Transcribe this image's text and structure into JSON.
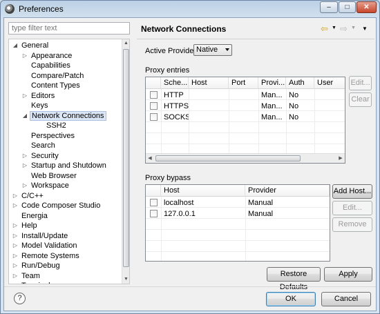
{
  "window": {
    "title": "Preferences",
    "icon": "eclipse-gear-icon",
    "controls": [
      "minimize-icon",
      "maximize-icon",
      "close-icon"
    ]
  },
  "filter": {
    "placeholder": "type filter text",
    "value": ""
  },
  "tree": {
    "items": [
      {
        "label": "General",
        "level": 0,
        "expander": "expanded"
      },
      {
        "label": "Appearance",
        "level": 1,
        "expander": "collapsed"
      },
      {
        "label": "Capabilities",
        "level": 1,
        "expander": "none"
      },
      {
        "label": "Compare/Patch",
        "level": 1,
        "expander": "none"
      },
      {
        "label": "Content Types",
        "level": 1,
        "expander": "none"
      },
      {
        "label": "Editors",
        "level": 1,
        "expander": "collapsed"
      },
      {
        "label": "Keys",
        "level": 1,
        "expander": "none"
      },
      {
        "label": "Network Connections",
        "level": 1,
        "expander": "expanded",
        "selected": true
      },
      {
        "label": "SSH2",
        "level": 2,
        "expander": "none"
      },
      {
        "label": "Perspectives",
        "level": 1,
        "expander": "none"
      },
      {
        "label": "Search",
        "level": 1,
        "expander": "none"
      },
      {
        "label": "Security",
        "level": 1,
        "expander": "collapsed"
      },
      {
        "label": "Startup and Shutdown",
        "level": 1,
        "expander": "collapsed"
      },
      {
        "label": "Web Browser",
        "level": 1,
        "expander": "none"
      },
      {
        "label": "Workspace",
        "level": 1,
        "expander": "collapsed"
      },
      {
        "label": "C/C++",
        "level": 0,
        "expander": "collapsed"
      },
      {
        "label": "Code Composer Studio",
        "level": 0,
        "expander": "collapsed"
      },
      {
        "label": "Energia",
        "level": 0,
        "expander": "none"
      },
      {
        "label": "Help",
        "level": 0,
        "expander": "collapsed"
      },
      {
        "label": "Install/Update",
        "level": 0,
        "expander": "collapsed"
      },
      {
        "label": "Model Validation",
        "level": 0,
        "expander": "collapsed"
      },
      {
        "label": "Remote Systems",
        "level": 0,
        "expander": "collapsed"
      },
      {
        "label": "Run/Debug",
        "level": 0,
        "expander": "collapsed"
      },
      {
        "label": "Team",
        "level": 0,
        "expander": "collapsed"
      },
      {
        "label": "Terminal",
        "level": 0,
        "expander": "none"
      }
    ]
  },
  "page": {
    "title": "Network Connections",
    "nav_icons": [
      "back-arrow-icon",
      "back-menu-icon",
      "forward-arrow-icon",
      "forward-menu-icon",
      "view-menu-icon"
    ]
  },
  "active_provider": {
    "label": "Active Provider:",
    "value": "Native"
  },
  "proxy_entries": {
    "label": "Proxy entries",
    "columns": [
      "Sche...",
      "Host",
      "Port",
      "Provi...",
      "Auth",
      "User"
    ],
    "rows": [
      {
        "scheme": "HTTP",
        "host": "",
        "port": "",
        "provider": "Man...",
        "auth": "No",
        "user": ""
      },
      {
        "scheme": "HTTPS",
        "host": "",
        "port": "",
        "provider": "Man...",
        "auth": "No",
        "user": ""
      },
      {
        "scheme": "SOCKS",
        "host": "",
        "port": "",
        "provider": "Man...",
        "auth": "No",
        "user": ""
      }
    ],
    "buttons": {
      "edit": "Edit...",
      "clear": "Clear"
    }
  },
  "proxy_bypass": {
    "label": "Proxy bypass",
    "columns": [
      "Host",
      "Provider"
    ],
    "rows": [
      {
        "host": "localhost",
        "provider": "Manual"
      },
      {
        "host": "127.0.0.1",
        "provider": "Manual"
      }
    ],
    "buttons": {
      "add_host": "Add Host...",
      "edit": "Edit...",
      "remove": "Remove"
    }
  },
  "footer": {
    "restore_defaults": "Restore Defaults",
    "apply": "Apply",
    "ok": "OK",
    "cancel": "Cancel",
    "help_glyph": "?"
  }
}
